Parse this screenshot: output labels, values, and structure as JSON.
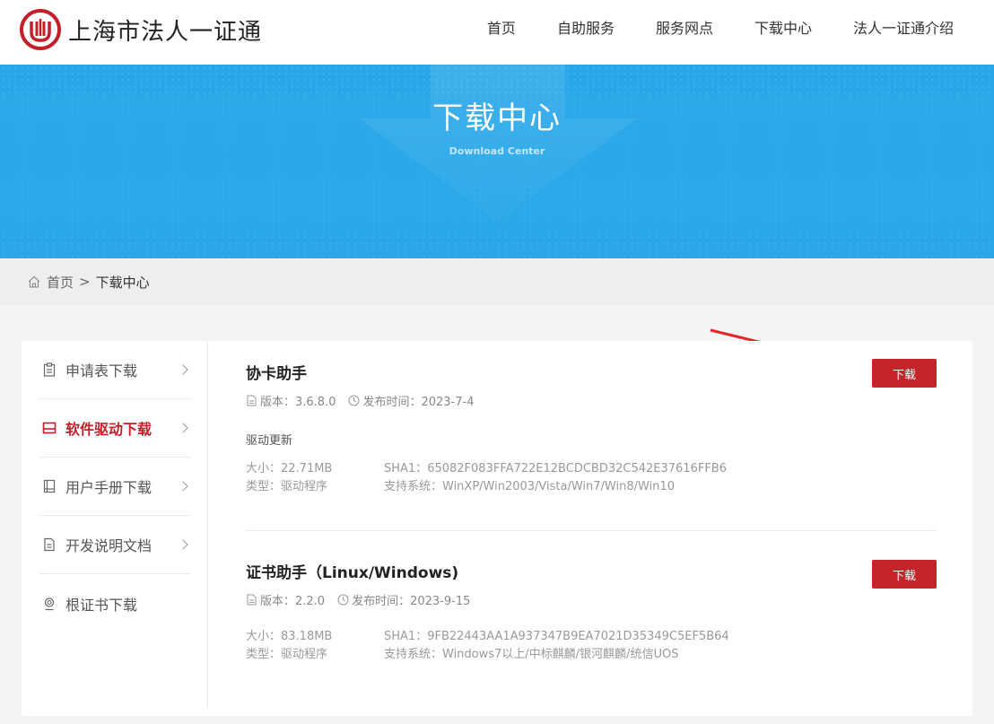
{
  "header": {
    "site_title": "上海市法人一证通",
    "nav": [
      "首页",
      "自助服务",
      "服务网点",
      "下载中心",
      "法人一证通介绍"
    ]
  },
  "banner": {
    "title": "下载中心",
    "subtitle": "Download Center"
  },
  "breadcrumb": {
    "home": "首页",
    "separator": ">",
    "current": "下载中心"
  },
  "sidebar": {
    "items": [
      {
        "label": "申请表下载",
        "icon": "clipboard-icon",
        "active": false
      },
      {
        "label": "软件驱动下载",
        "icon": "monitor-icon",
        "active": true
      },
      {
        "label": "用户手册下载",
        "icon": "book-icon",
        "active": false
      },
      {
        "label": "开发说明文档",
        "icon": "document-icon",
        "active": false
      },
      {
        "label": "根证书下载",
        "icon": "badge-icon",
        "active": false
      }
    ]
  },
  "downloads": [
    {
      "title": "协卡助手",
      "version_label": "版本：3.6.8.0",
      "date_label": "发布时间：2023-7-4",
      "note": "驱动更新",
      "size": "大小：22.71MB",
      "sha1": "SHA1：65082F083FFA722E12BCDCBD32C542E37616FFB6",
      "type": "类型：驱动程序",
      "os": "支持系统：WinXP/Win2003/Vista/Win7/Win8/Win10",
      "button": "下载"
    },
    {
      "title": "证书助手（Linux/Windows)",
      "version_label": "版本：2.2.0",
      "date_label": "发布时间：2023-9-15",
      "size": "大小：83.18MB",
      "sha1": "SHA1：9FB22443AA1A937347B9EA7021D35349C5EF5B64",
      "type": "类型：驱动程序",
      "os": "支持系统：Windows7以上/中标麒麟/银河麒麟/统信UOS",
      "button": "下载"
    }
  ],
  "colors": {
    "brand_red": "#c5242b",
    "banner_blue": "#2ba8e9",
    "annotation_red": "#e8242a"
  }
}
